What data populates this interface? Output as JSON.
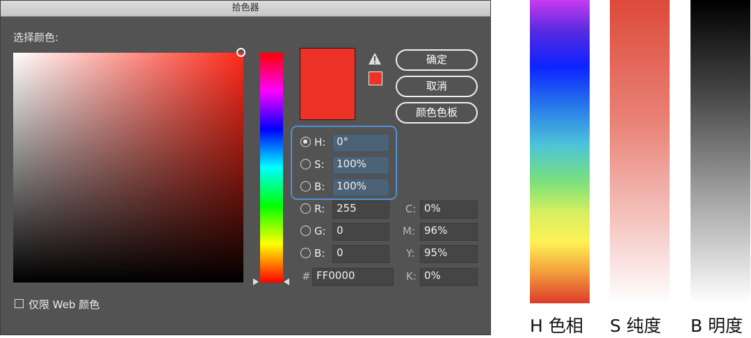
{
  "dialog": {
    "title": "拾色器",
    "prompt": "选择颜色:",
    "color_hex": "#ED3227"
  },
  "buttons": {
    "ok": "确定",
    "cancel": "取消",
    "swatches": "颜色色板"
  },
  "hsb": {
    "h": {
      "label": "H:",
      "value": "0°",
      "selected": true
    },
    "s": {
      "label": "S:",
      "value": "100%",
      "selected": false
    },
    "b": {
      "label": "B:",
      "value": "100%",
      "selected": false
    }
  },
  "rgb": {
    "r": {
      "label": "R:",
      "value": "255"
    },
    "g": {
      "label": "G:",
      "value": "0"
    },
    "b": {
      "label": "B:",
      "value": "0"
    }
  },
  "hex": {
    "label": "#",
    "value": "FF0000"
  },
  "cmyk": {
    "c": {
      "label": "C:",
      "value": "0%"
    },
    "m": {
      "label": "M:",
      "value": "96%"
    },
    "y": {
      "label": "Y:",
      "value": "95%"
    },
    "k": {
      "label": "K:",
      "value": "0%"
    }
  },
  "web_only": {
    "label": "仅限 Web 颜色",
    "checked": false
  },
  "bars": {
    "h": "H 色相",
    "s": "S 纯度",
    "b": "B 明度"
  }
}
